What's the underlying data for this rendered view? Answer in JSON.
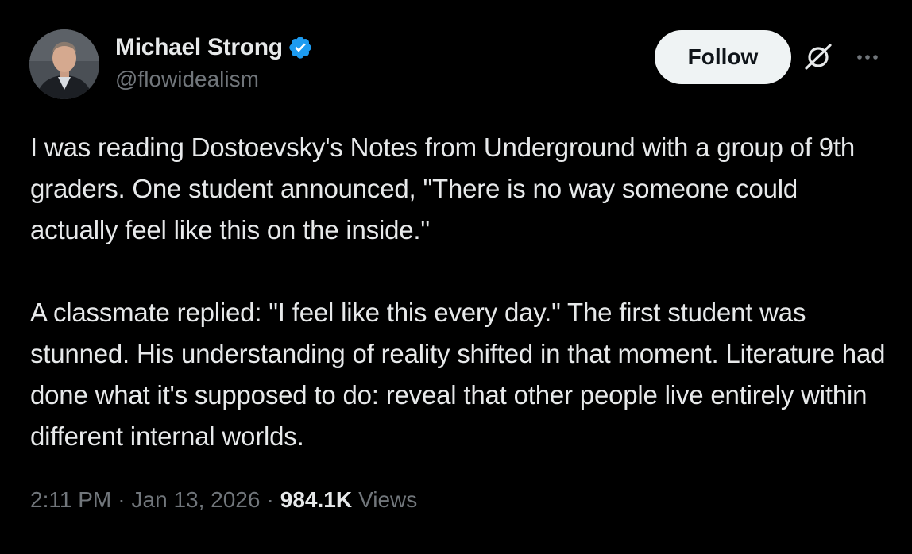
{
  "author": {
    "name": "Michael Strong",
    "handle": "@flowidealism",
    "verified_color": "#1d9bf0",
    "avatar_icon": "profile-photo"
  },
  "actions": {
    "follow_label": "Follow",
    "grok_icon": "grok-icon",
    "more_icon": "more-icon"
  },
  "tweet": {
    "paragraph_1": "I was reading Dostoevsky's Notes from Underground with a group of 9th graders. One student announced, \"There is no way someone could actually feel like this on the inside.\"",
    "paragraph_2": "A classmate replied: \"I feel like this every day.\" The first student was stunned. His understanding of reality shifted in that moment. Literature had done what it's supposed to do: reveal that other people live entirely within different internal worlds."
  },
  "meta": {
    "time": "2:11 PM",
    "separator": "·",
    "date": "Jan 13, 2026",
    "views_count": "984.1K",
    "views_label": "Views"
  },
  "colors": {
    "background": "#000000",
    "text_primary": "#e7e9ea",
    "text_secondary": "#71767b",
    "follow_bg": "#eff3f4"
  }
}
